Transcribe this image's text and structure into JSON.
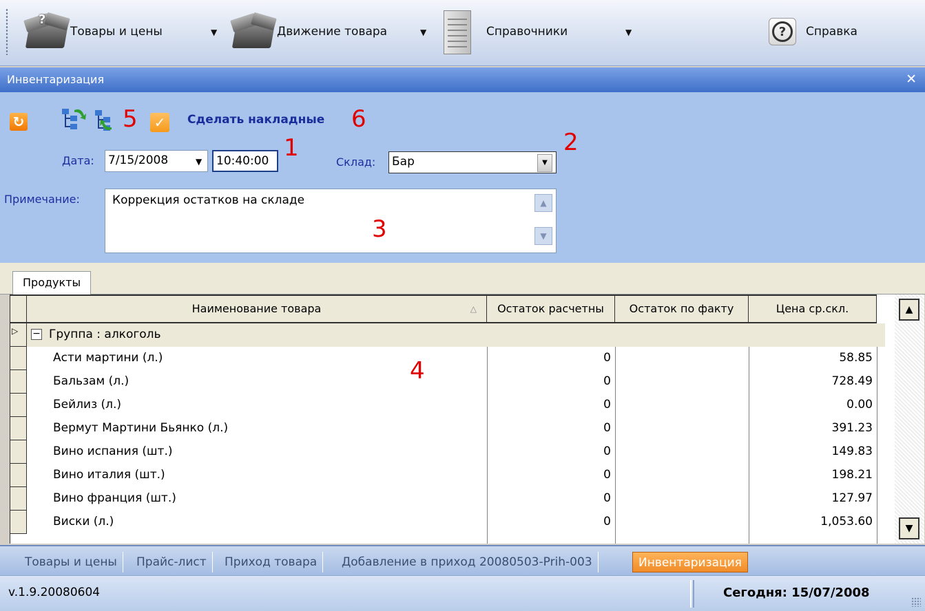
{
  "toolbar": {
    "items": [
      {
        "label": "Товары и цены",
        "icon": "box-question-icon"
      },
      {
        "label": "Движение товара",
        "icon": "box-icon"
      },
      {
        "label": "Справочники",
        "icon": "notebook-icon"
      },
      {
        "label": "Справка",
        "icon": "help-icon"
      }
    ]
  },
  "window": {
    "title": "Инвентаризация",
    "close": "✕"
  },
  "form": {
    "make_invoices_label": "Сделать накладные",
    "date_label": "Дата:",
    "date_value": "7/15/2008",
    "time_value": "10:40:00",
    "warehouse_label": "Склад:",
    "warehouse_value": "Бар",
    "note_label": "Примечание:",
    "note_value": "Коррекция остатков на складе",
    "annotations": {
      "a1": "1",
      "a2": "2",
      "a3": "3",
      "a4": "4",
      "a5": "5",
      "a6": "6"
    }
  },
  "tabs": {
    "products": "Продукты"
  },
  "grid": {
    "columns": [
      "Наименование товара",
      "Остаток расчетны",
      "Остаток по факту",
      "Цена ср.скл."
    ],
    "group": "Группа : алкоголь",
    "rows": [
      {
        "name": "Асти мартини (л.)",
        "calc": "0",
        "fact": "",
        "price": "58.85"
      },
      {
        "name": "Бальзам (л.)",
        "calc": "0",
        "fact": "",
        "price": "728.49"
      },
      {
        "name": "Бейлиз (л.)",
        "calc": "0",
        "fact": "",
        "price": "0.00"
      },
      {
        "name": "Вермут Мартини Бьянко (л.)",
        "calc": "0",
        "fact": "",
        "price": "391.23"
      },
      {
        "name": "Вино испания (шт.)",
        "calc": "0",
        "fact": "",
        "price": "149.83"
      },
      {
        "name": "Вино италия (шт.)",
        "calc": "0",
        "fact": "",
        "price": "198.21"
      },
      {
        "name": "Вино франция (шт.)",
        "calc": "0",
        "fact": "",
        "price": "127.97"
      },
      {
        "name": "Виски (л.)",
        "calc": "0",
        "fact": "",
        "price": "1,053.60"
      }
    ]
  },
  "window_tabs": [
    "Товары и цены",
    "Прайс-лист",
    "Приход товара",
    "Добавление в приход 20080503-Prih-003",
    "Инвентаризация"
  ],
  "status": {
    "version": "v.1.9.20080604",
    "today": "Сегодня: 15/07/2008"
  },
  "colors": {
    "accent": "#3f6fc9",
    "form_bg": "#a9c4ec",
    "active_tab": "#f08c28",
    "annotation": "#e00000"
  }
}
